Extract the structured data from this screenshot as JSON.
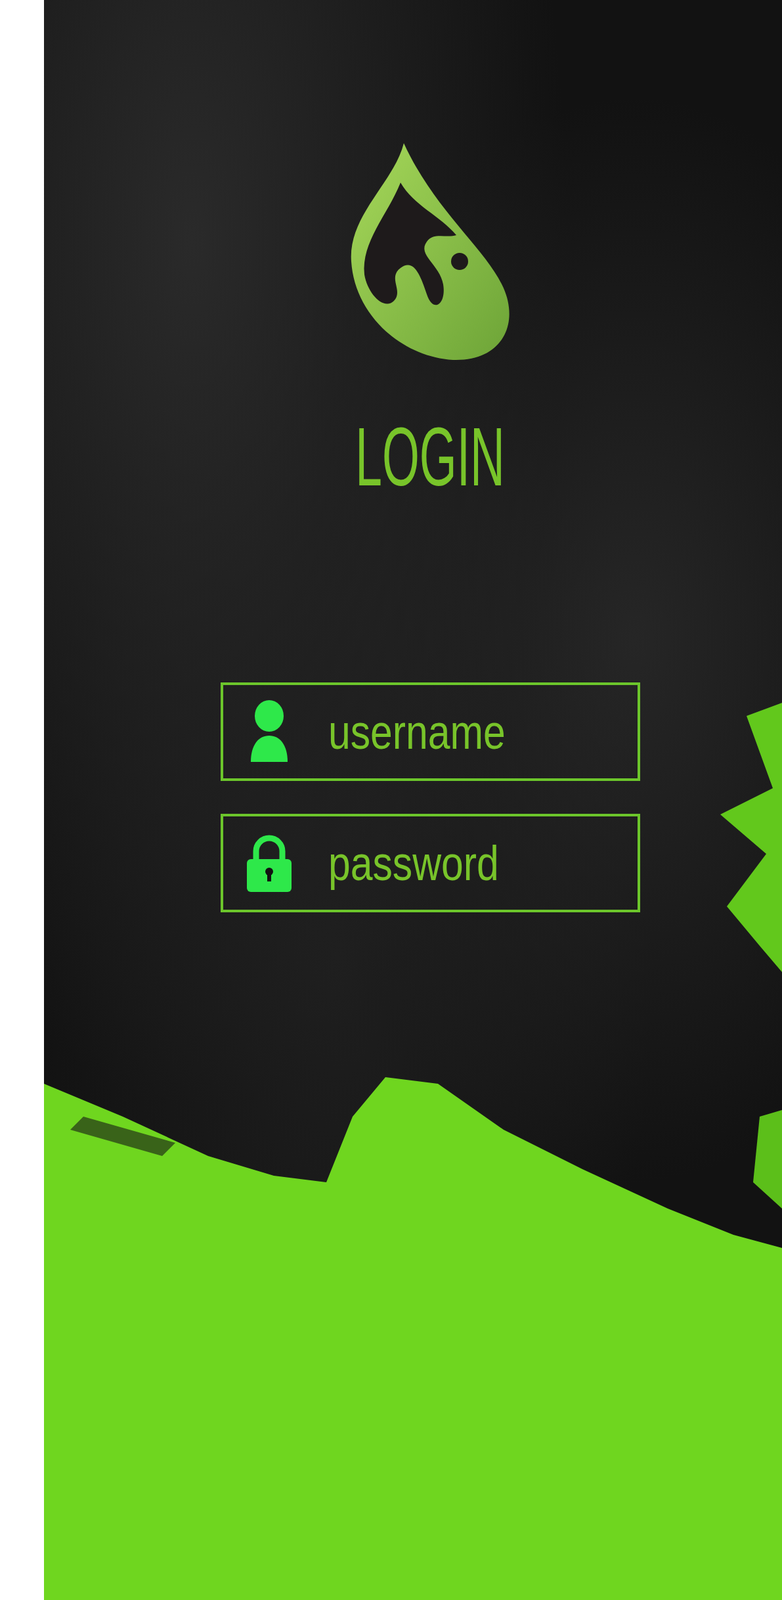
{
  "title": "LOGIN",
  "fields": [
    {
      "placeholder": "username",
      "kind": "text"
    },
    {
      "placeholder": "password",
      "kind": "password"
    }
  ]
}
